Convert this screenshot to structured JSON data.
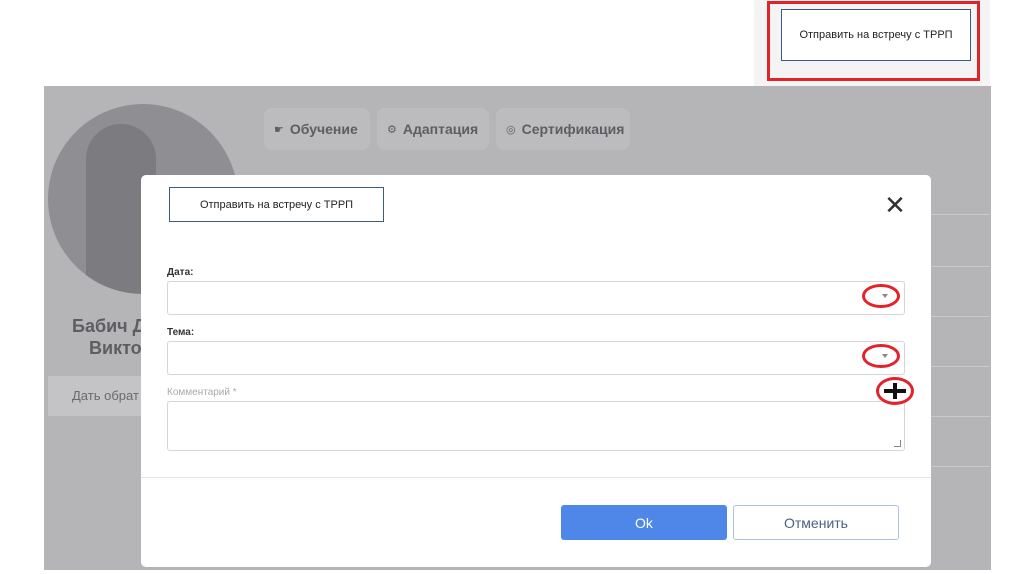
{
  "callout": {
    "label": "Отправить на встречу с ТРРП"
  },
  "background": {
    "tabs": [
      {
        "icon": "graduation-cap-icon",
        "glyph": "☛",
        "label": "Обучение"
      },
      {
        "icon": "adaptation-icon",
        "glyph": "⚙",
        "label": "Адаптация"
      },
      {
        "icon": "certificate-icon",
        "glyph": "◎",
        "label": "Сертификация"
      }
    ],
    "profile_name_line1": "Бабич Д",
    "profile_name_line2": "Викто",
    "feedback_button": "Дать обрат"
  },
  "dialog": {
    "title": "Отправить на встречу с ТРРП",
    "close_glyph": "✕",
    "date_label": "Дата:",
    "topic_label": "Тема:",
    "comment_label": "Комментарий *",
    "ok_label": "Ok",
    "cancel_label": "Отменить"
  },
  "colors": {
    "annotation": "#e3232a",
    "primary": "#4e87e8",
    "overlay": "#b5b5b8"
  }
}
